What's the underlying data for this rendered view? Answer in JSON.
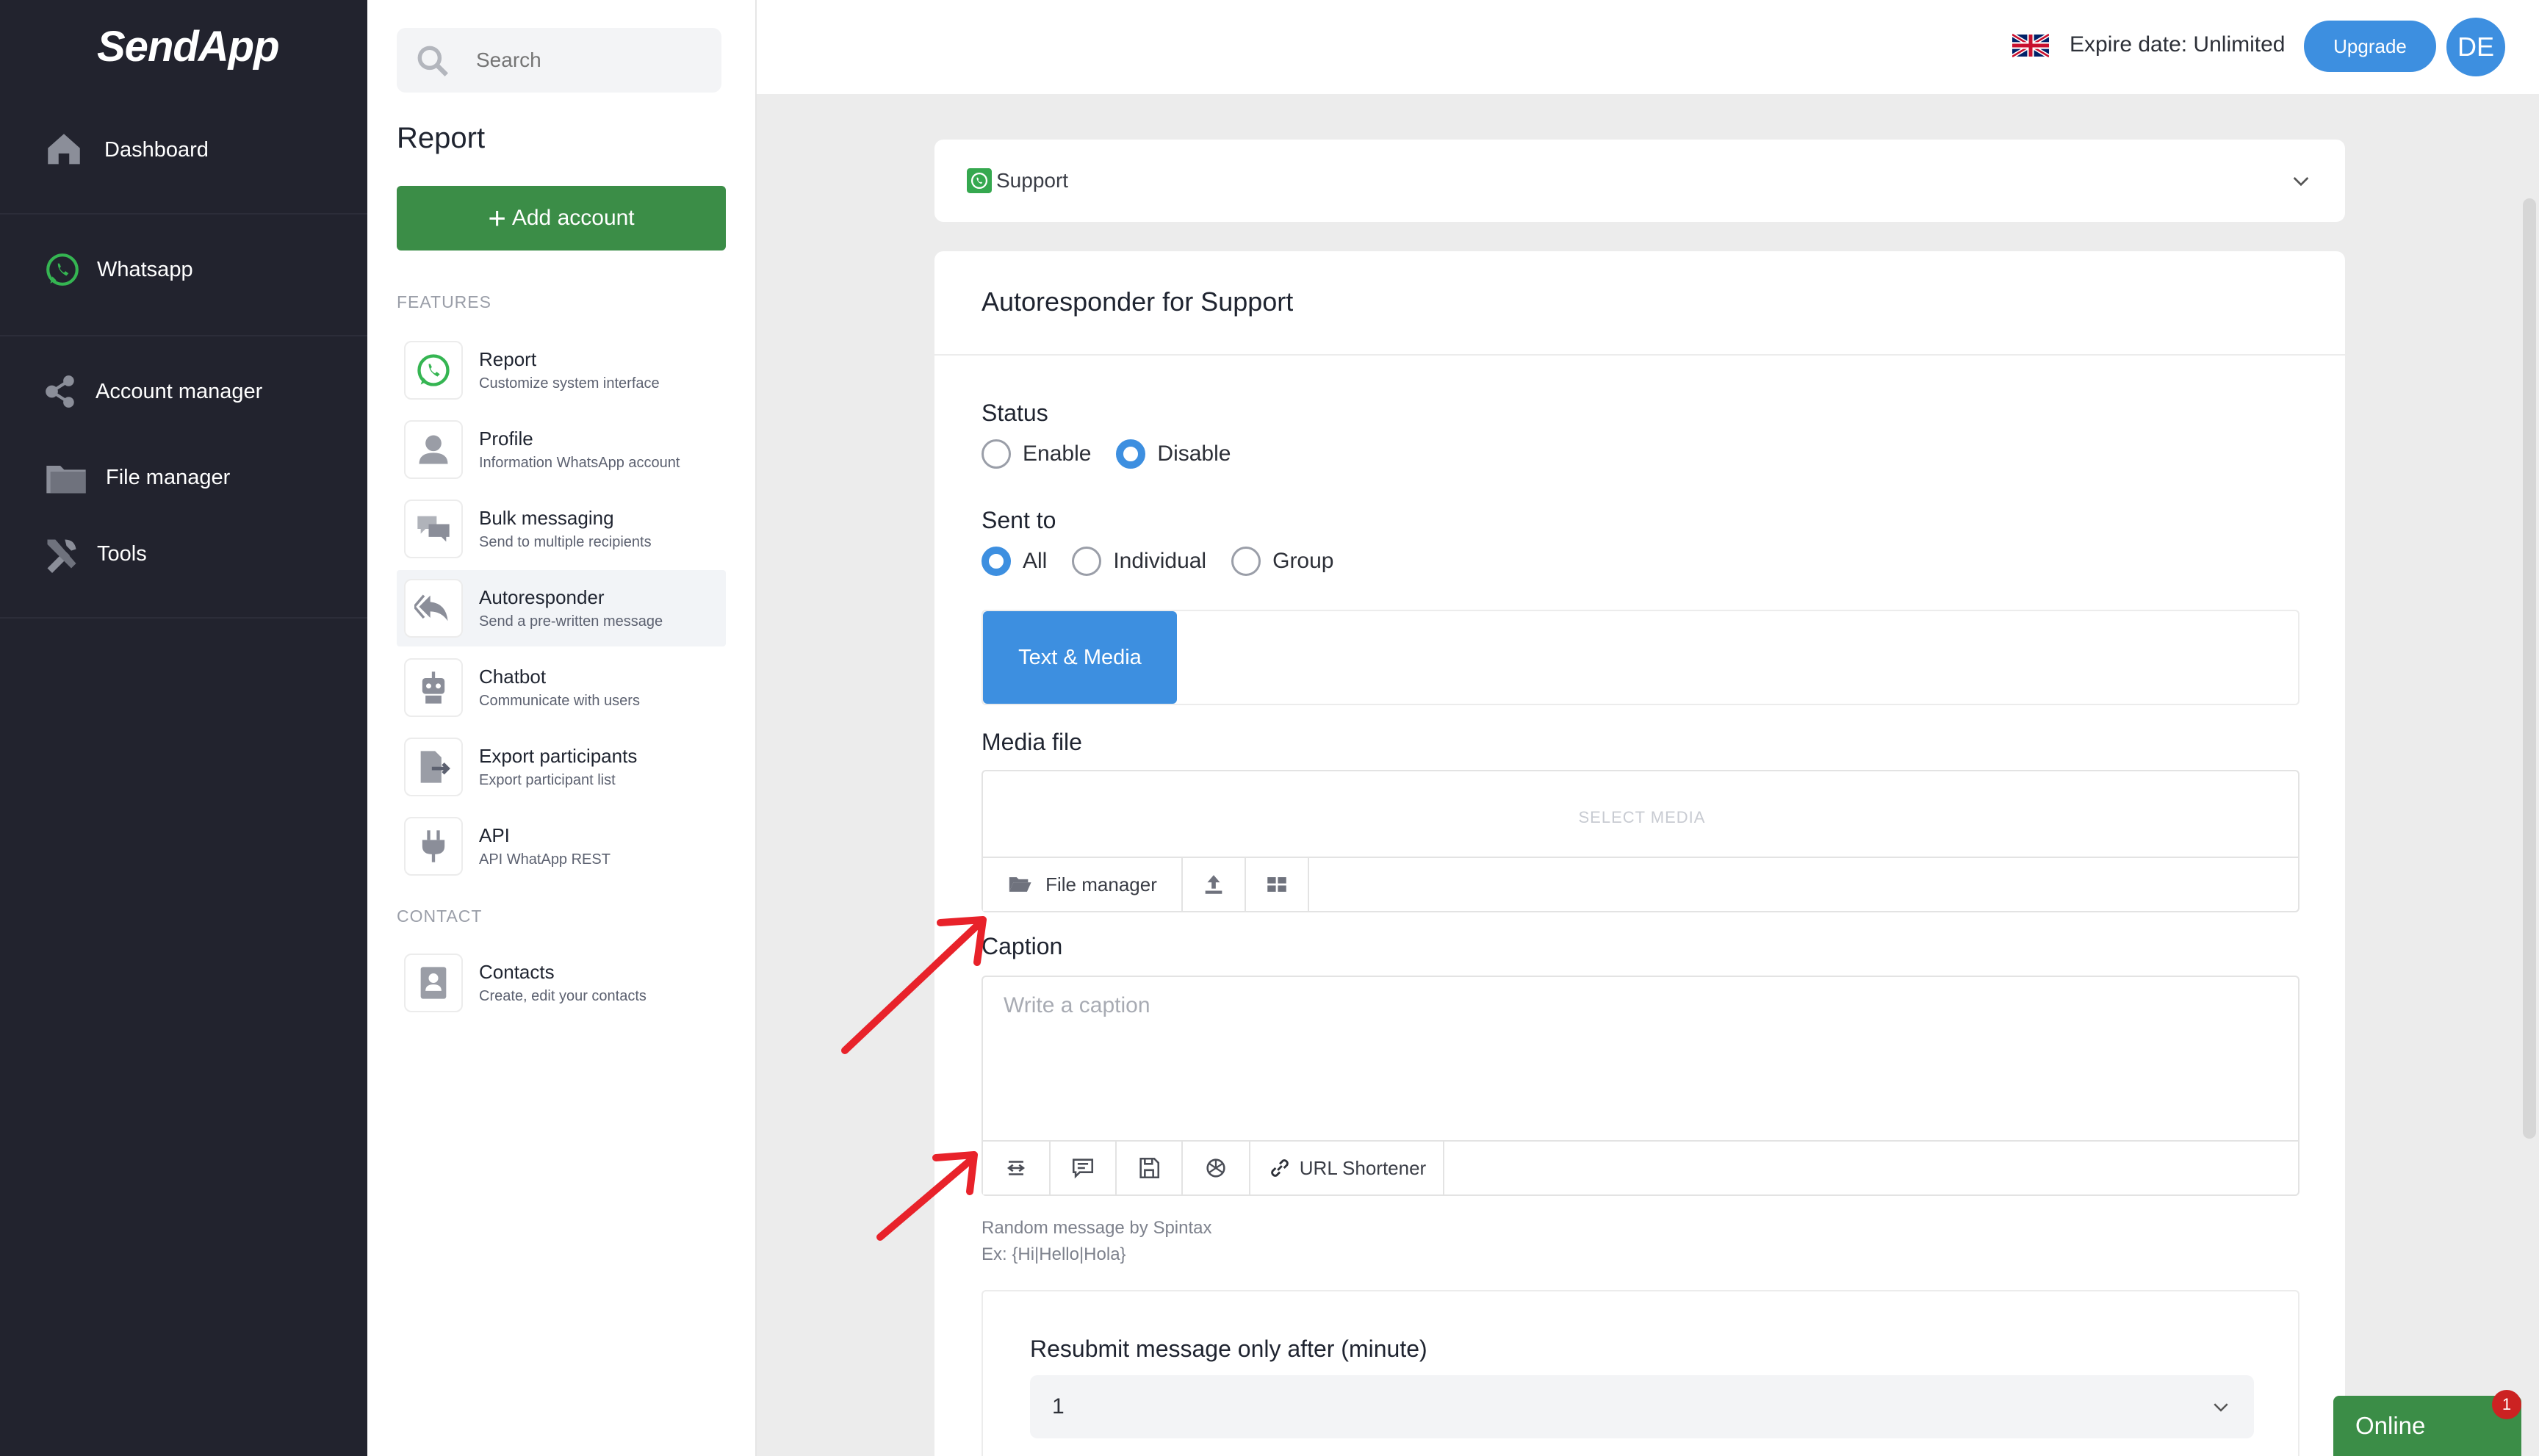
{
  "app": {
    "logo_text": "SendApp"
  },
  "nav": {
    "items": [
      {
        "label": "Dashboard",
        "icon": "home-icon"
      },
      {
        "label": "Whatsapp",
        "icon": "whatsapp-icon"
      },
      {
        "label": "Account manager",
        "icon": "share-nodes-icon"
      },
      {
        "label": "File manager",
        "icon": "folder-icon"
      },
      {
        "label": "Tools",
        "icon": "tools-icon"
      }
    ]
  },
  "panel": {
    "search_placeholder": "Search",
    "title": "Report",
    "add_account_label": "Add account",
    "features_heading": "FEATURES",
    "contact_heading": "CONTACT",
    "features": [
      {
        "title": "Report",
        "desc": "Customize system interface",
        "icon": "whatsapp-icon"
      },
      {
        "title": "Profile",
        "desc": "Information WhatsApp account",
        "icon": "user-icon"
      },
      {
        "title": "Bulk messaging",
        "desc": "Send to multiple recipients",
        "icon": "chat-bubbles-icon"
      },
      {
        "title": "Autoresponder",
        "desc": "Send a pre-written message",
        "icon": "reply-icon"
      },
      {
        "title": "Chatbot",
        "desc": "Communicate with users",
        "icon": "robot-icon"
      },
      {
        "title": "Export participants",
        "desc": "Export participant list",
        "icon": "export-icon"
      },
      {
        "title": "API",
        "desc": "API WhatApp REST",
        "icon": "plug-icon"
      }
    ],
    "contacts": [
      {
        "title": "Contacts",
        "desc": "Create, edit your contacts",
        "icon": "contact-book-icon"
      }
    ]
  },
  "topbar": {
    "flag": "uk-flag-icon",
    "expire_text": "Expire date: Unlimited",
    "upgrade_label": "Upgrade",
    "avatar_initials": "DE"
  },
  "account": {
    "name": "Support"
  },
  "card": {
    "title": "Autoresponder for Support",
    "status_label": "Status",
    "status_options": [
      "Enable",
      "Disable"
    ],
    "status_selected": "Disable",
    "sent_to_label": "Sent to",
    "sent_to_options": [
      "All",
      "Individual",
      "Group"
    ],
    "sent_to_selected": "All",
    "tab_label": "Text & Media",
    "media_label": "Media file",
    "select_media": "SELECT MEDIA",
    "file_manager_label": "File manager",
    "caption_label": "Caption",
    "caption_placeholder": "Write a caption",
    "url_shortener_label": "URL Shortener",
    "spintax_hint": "Random message by Spintax",
    "spintax_example": "Ex: {Hi|Hello|Hola}",
    "resubmit_label": "Resubmit message only after (minute)",
    "resubmit_value": "1"
  },
  "chat_widget": {
    "label": "Online",
    "badge_count": "1"
  },
  "colors": {
    "sidebar_bg": "#22232e",
    "primary_green": "#3b8d47",
    "accent_blue": "#3d8fe0",
    "annotation_red": "#e8222a"
  }
}
